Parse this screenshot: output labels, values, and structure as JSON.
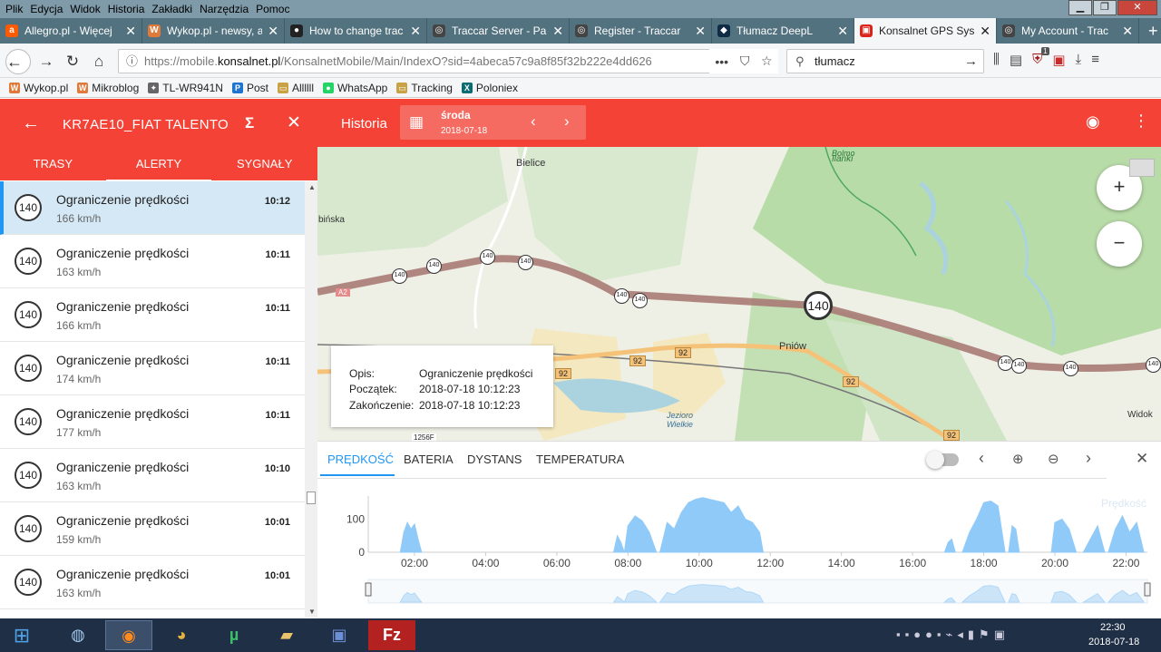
{
  "menubar": {
    "items": [
      "Plik",
      "Edycja",
      "Widok",
      "Historia",
      "Zakładki",
      "Narzędzia",
      "Pomoc"
    ]
  },
  "tabs": [
    {
      "label": "Allegro.pl - Więcej",
      "icon": "allegro-icon",
      "color": "#ff5a00",
      "glyph": "a"
    },
    {
      "label": "Wykop.pl - newsy, a",
      "icon": "wykop-icon",
      "color": "#e07a3a",
      "glyph": "W"
    },
    {
      "label": "How to change trac",
      "icon": "github-icon",
      "color": "#222222",
      "glyph": "●"
    },
    {
      "label": "Traccar Server - Pa",
      "icon": "traccar-icon",
      "color": "#444444",
      "glyph": "◎"
    },
    {
      "label": "Register - Traccar",
      "icon": "traccar-icon",
      "color": "#444444",
      "glyph": "◎"
    },
    {
      "label": "Tłumacz DeepL",
      "icon": "deepl-icon",
      "color": "#0f2b46",
      "glyph": "◆"
    },
    {
      "label": "Konsalnet GPS Syst",
      "icon": "konsalnet-icon",
      "color": "#d9251c",
      "glyph": "▣",
      "active": true
    },
    {
      "label": "My Account - Trac",
      "icon": "traccar-icon",
      "color": "#444444",
      "glyph": "◎"
    }
  ],
  "nav": {
    "url_prefix": "https://mobile.",
    "url_domain": "konsalnet.pl",
    "url_rest": "/KonsalnetMobile/Main/IndexO?sid=4abeca57c9a8f85f32b222e4dd626",
    "search_value": "tłumacz",
    "ublock_count": "1"
  },
  "bookmarks": [
    {
      "label": "Wykop.pl",
      "color": "#e07a3a",
      "glyph": "W"
    },
    {
      "label": "Mikroblog",
      "color": "#e07a3a",
      "glyph": "W"
    },
    {
      "label": "TL-WR941N",
      "color": "#666666",
      "glyph": "✦"
    },
    {
      "label": "Post",
      "color": "#1e74d1",
      "glyph": "P"
    },
    {
      "label": "Allllll",
      "color": "#c9a245",
      "glyph": "▭"
    },
    {
      "label": "WhatsApp",
      "color": "#25d366",
      "glyph": "●"
    },
    {
      "label": "Tracking",
      "color": "#c9a245",
      "glyph": "▭"
    },
    {
      "label": "Poloniex",
      "color": "#0b6b73",
      "glyph": "X"
    }
  ],
  "app": {
    "vehicle": "KR7AE10_FIAT TALENTO",
    "subtabs": [
      "TRASY",
      "ALERTY",
      "SYGNAŁY"
    ],
    "history_label": "Historia",
    "day": "środa",
    "date": "2018-07-18",
    "colors": {
      "primary": "#f44336",
      "accent": "#2196f3"
    }
  },
  "alerts": [
    {
      "badge": "140",
      "title": "Ograniczenie prędkości",
      "speed": "166 km/h",
      "time": "10:12",
      "selected": true
    },
    {
      "badge": "140",
      "title": "Ograniczenie prędkości",
      "speed": "163 km/h",
      "time": "10:11"
    },
    {
      "badge": "140",
      "title": "Ograniczenie prędkości",
      "speed": "166 km/h",
      "time": "10:11"
    },
    {
      "badge": "140",
      "title": "Ograniczenie prędkości",
      "speed": "174 km/h",
      "time": "10:11"
    },
    {
      "badge": "140",
      "title": "Ograniczenie prędkości",
      "speed": "177 km/h",
      "time": "10:11"
    },
    {
      "badge": "140",
      "title": "Ograniczenie prędkości",
      "speed": "163 km/h",
      "time": "10:10"
    },
    {
      "badge": "140",
      "title": "Ograniczenie prędkości",
      "speed": "159 km/h",
      "time": "10:01"
    },
    {
      "badge": "140",
      "title": "Ograniczenie prędkości",
      "speed": "163 km/h",
      "time": "10:01"
    }
  ],
  "map": {
    "places": [
      "Bielice",
      "Pniów",
      "Jezioro Wielkie",
      "Bolmo",
      "Ilanki",
      "Widok",
      "bińska"
    ],
    "road_labels": [
      "92",
      "92",
      "92",
      "92",
      "92",
      "A2",
      "1256F"
    ],
    "main_badge": "140",
    "speed_marks": [
      "140",
      "140",
      "140",
      "140",
      "140",
      "140",
      "140",
      "140",
      "140",
      "140"
    ],
    "zoom_in": "+",
    "zoom_out": "−",
    "popup": {
      "opis_label": "Opis:",
      "opis_value": "Ograniczenie prędkości",
      "start_label": "Początek:",
      "start_value": "2018-07-18 10:12:23",
      "end_label": "Zakończenie:",
      "end_value": "2018-07-18 10:12:23"
    }
  },
  "chart_panel": {
    "tabs": [
      "PRĘDKOŚĆ",
      "BATERIA",
      "DYSTANS",
      "TEMPERATURA"
    ]
  },
  "chart_data": {
    "type": "area",
    "legend": "Prędkość",
    "legend_position": "top-right",
    "xlabel": "",
    "ylabel": "",
    "x_ticks": [
      "02:00",
      "04:00",
      "06:00",
      "08:00",
      "10:00",
      "12:00",
      "14:00",
      "16:00",
      "18:00",
      "20:00",
      "22:00"
    ],
    "y_ticks": [
      "0",
      "100"
    ],
    "xlim": [
      0.7,
      22.6
    ],
    "ylim": [
      0,
      170
    ],
    "series": [
      {
        "color": "#90caf9",
        "segments": [
          {
            "x": [
              1.6,
              1.7,
              1.8,
              1.9,
              2.0,
              2.1,
              2.2
            ],
            "y": [
              0,
              60,
              90,
              70,
              85,
              40,
              0
            ]
          },
          {
            "x": [
              7.6,
              7.7,
              7.8,
              7.9
            ],
            "y": [
              0,
              50,
              30,
              0
            ]
          },
          {
            "x": [
              7.9,
              8.0,
              8.2,
              8.4,
              8.6,
              8.8
            ],
            "y": [
              0,
              80,
              110,
              95,
              60,
              0
            ]
          },
          {
            "x": [
              8.9,
              9.1,
              9.3,
              9.5,
              9.7,
              9.9,
              10.1,
              10.3,
              10.5,
              10.7,
              10.9,
              11.1,
              11.3,
              11.5,
              11.7,
              11.8
            ],
            "y": [
              0,
              90,
              70,
              120,
              150,
              160,
              165,
              160,
              155,
              150,
              120,
              140,
              100,
              90,
              60,
              0
            ]
          },
          {
            "x": [
              16.9,
              17.0,
              17.1,
              17.2
            ],
            "y": [
              0,
              30,
              40,
              0
            ]
          },
          {
            "x": [
              17.4,
              17.6,
              17.8,
              18.0,
              18.2,
              18.4,
              18.6
            ],
            "y": [
              0,
              60,
              100,
              150,
              155,
              140,
              0
            ]
          },
          {
            "x": [
              18.7,
              18.8,
              18.9,
              19.0
            ],
            "y": [
              0,
              80,
              70,
              0
            ]
          },
          {
            "x": [
              19.9,
              20.0,
              20.2,
              20.4,
              20.6
            ],
            "y": [
              0,
              90,
              100,
              70,
              0
            ]
          },
          {
            "x": [
              20.8,
              21.0,
              21.2,
              21.4
            ],
            "y": [
              0,
              40,
              80,
              0
            ]
          },
          {
            "x": [
              21.5,
              21.7,
              21.9,
              22.1,
              22.3,
              22.5
            ],
            "y": [
              0,
              70,
              110,
              60,
              90,
              0
            ]
          }
        ]
      }
    ]
  },
  "taskbar": {
    "time": "22:30",
    "date": "2018-07-18"
  }
}
